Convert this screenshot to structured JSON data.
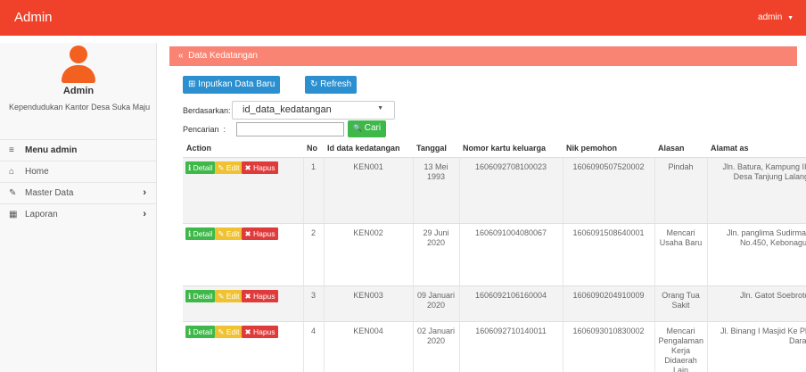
{
  "topbar": {
    "brand": "Admin",
    "user": "admin",
    "user_caret": "▼"
  },
  "sidebar": {
    "name": "Admin",
    "description": "Kependudukan Kantor Desa Suka Maju",
    "menu": [
      {
        "icon": "≡",
        "icon_name": "menu-icon",
        "label": "Menu admin",
        "arrow": ""
      },
      {
        "icon": "⌂",
        "icon_name": "home-icon",
        "label": "Home",
        "arrow": ""
      },
      {
        "icon": "✎",
        "icon_name": "edit-icon",
        "label": "Master Data",
        "arrow": "›"
      },
      {
        "icon": "▦",
        "icon_name": "calendar-icon",
        "label": "Laporan",
        "arrow": "›"
      }
    ]
  },
  "panel": {
    "icon": "«",
    "title": "Data Kedatangan"
  },
  "toolbar": {
    "add_icon": "⊞",
    "add_label": "Inputkan Data Baru",
    "refresh_icon": "↻",
    "refresh_label": "Refresh"
  },
  "filter": {
    "by_label": "Berdasarkan",
    "by_value": "id_data_kedatangan",
    "search_label": "Pencarian",
    "search_value": "",
    "search_icon": "🔍",
    "search_button": "Cari"
  },
  "table": {
    "headers": [
      "Action",
      "No",
      "Id data kedatangan",
      "Tanggal",
      "Nomor kartu keluarga",
      "Nik pemohon",
      "Alasan",
      "Alamat as"
    ],
    "actions": {
      "detail": "ℹ Detail",
      "edit": "✎ Edit",
      "hapus": "✖ Hapus"
    },
    "rows": [
      {
        "no": "1",
        "id": "KEN001",
        "tanggal": "13 Mei 1993",
        "kk": "1606092708100023",
        "nik": "1606090507520002",
        "alasan": "Pindah",
        "alamat": "Jln. Batura, Kampung II, Desa Tanjung Lalang"
      },
      {
        "no": "2",
        "id": "KEN002",
        "tanggal": "29 Juni 2020",
        "kk": "1606091004080067",
        "nik": "1606091508640001",
        "alasan": "Mencari Usaha Baru",
        "alamat": "Jln. panglima Sudirmar No.450, Kebonagui"
      },
      {
        "no": "3",
        "id": "KEN003",
        "tanggal": "09 Januari 2020",
        "kk": "1606092106160004",
        "nik": "1606090204910009",
        "alasan": "Orang Tua Sakit",
        "alamat": "Jln. Gatot Soebrotc"
      },
      {
        "no": "4",
        "id": "KEN004",
        "tanggal": "02 Januari 2020",
        "kk": "1606092710140011",
        "nik": "1606093010830002",
        "alasan": "Mencari Pengalaman Kerja Didaerah Lain",
        "alamat": "Jl. Binang I Masjid Ke Plj Darat"
      }
    ]
  }
}
